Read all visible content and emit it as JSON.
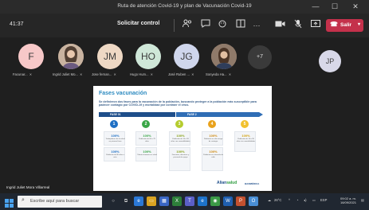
{
  "window": {
    "title": "Ruta de atención Covid-19 y plan de Vacunación Covid-19",
    "minimize": "—",
    "maximize": "☐",
    "close": "✕"
  },
  "toolbar": {
    "timer": "41:37",
    "request_control": "Solicitar control",
    "more_dots": "···",
    "leave_label": "Salir"
  },
  "participants": [
    {
      "initials": "F",
      "label": "Facunar...",
      "color": "#f7c8c8"
    },
    {
      "initials": "",
      "label": "Ingrid Juliet Mo...",
      "color": "#b89a84"
    },
    {
      "initials": "JM",
      "label": "Jose fernan...",
      "color": "#eed8c4"
    },
    {
      "initials": "HO",
      "label": "Hugo Hum...",
      "color": "#cfe7d8"
    },
    {
      "initials": "JG",
      "label": "José Ruben ...",
      "color": "#cfd6ec"
    },
    {
      "initials": "",
      "label": "Sonyeda Ha...",
      "color": "#9c8270"
    }
  ],
  "more_participants": "+7",
  "self_avatar": "JP",
  "slide": {
    "title": "Fases vacunación",
    "subtitle": "Se definieron dos fases para la vacunación de la población, buscando proteger a la población más susceptible para padecer contagio por COVID-19 y mortalidad por contraer el virus.",
    "phase1": "FASE 01",
    "phase2": "FASE 2",
    "stages": [
      {
        "num": "1",
        "color": "#1e6fc4",
        "pct1": "100%",
        "pct2": "100%",
        "desc1": "Trabajadores de la salud en primera línea",
        "desc2": "Población de 80 años o más"
      },
      {
        "num": "2",
        "color": "#3aa647",
        "pct1": "100%",
        "pct2": "100%",
        "desc1": "Población de 60 a 79 años",
        "desc2": "Talento humano en salud"
      },
      {
        "num": "3",
        "color": "#b5cc2e",
        "pct1": "100%",
        "pct2": "100%",
        "desc1": "Población de 16 a 59 años con comorbilidades",
        "desc2": "Docentes, directivos y personal de apoyo"
      },
      {
        "num": "4",
        "color": "#e9a21c",
        "pct1": "100%",
        "pct2": "100%",
        "desc1": "Población en alto riesgo de contagio",
        "desc2": "Población en situación de calle"
      },
      {
        "num": "5",
        "color": "#f2c12e",
        "pct1": "100%",
        "pct2": "",
        "desc1": "Población de 16 a 59 años sin comorbilidades",
        "desc2": ""
      }
    ],
    "logo": "Alian",
    "logo_accent": "salud",
    "logo2": "BANMÉDICA"
  },
  "presenter_name": "Ingrid Juliet Mora Villarreal",
  "taskbar": {
    "search_placeholder": "Escribe aquí para buscar",
    "weather": "26°C",
    "lang": "ESP",
    "time": "09:02 a. m.",
    "date": "16/09/2021"
  }
}
